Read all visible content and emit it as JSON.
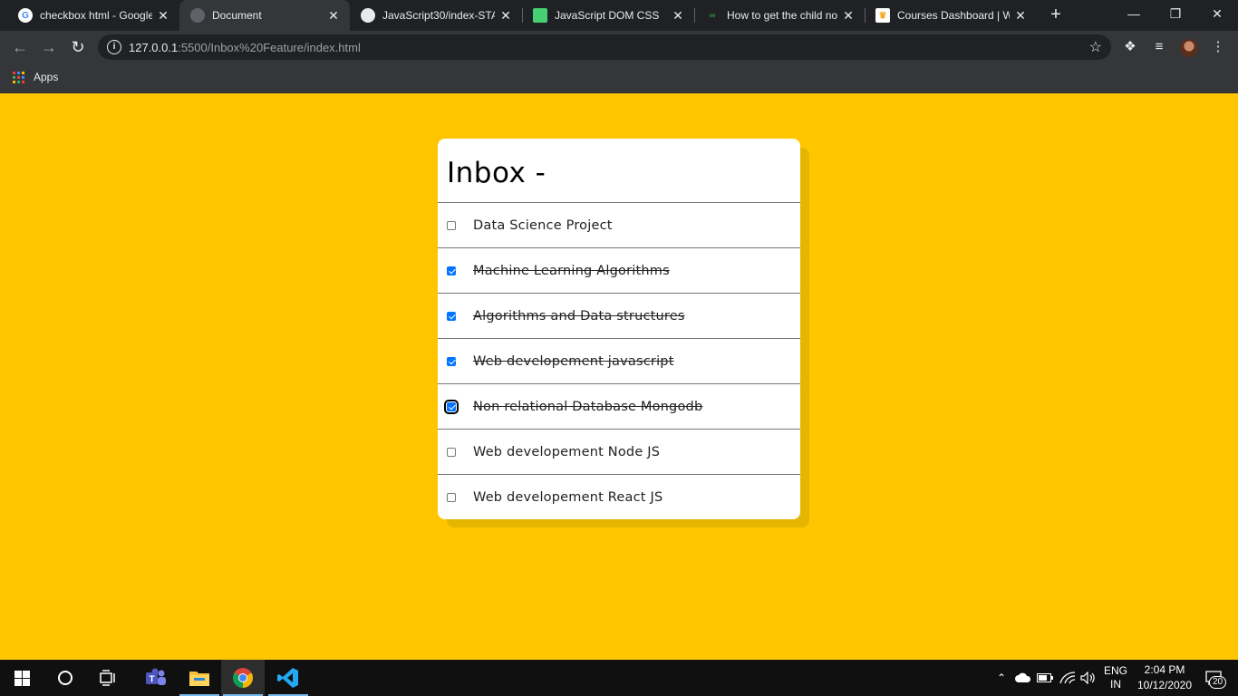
{
  "browser": {
    "tabs": [
      {
        "title": "checkbox html - Google",
        "favicon": "google-icon",
        "active": false
      },
      {
        "title": "Document",
        "favicon": "globe-icon",
        "active": true
      },
      {
        "title": "JavaScript30/index-STA",
        "favicon": "github-icon",
        "active": false
      },
      {
        "title": "JavaScript DOM CSS",
        "favicon": "codepen-icon",
        "active": false
      },
      {
        "title": "How to get the child no",
        "favicon": "geeksforgeeks-icon",
        "active": false
      },
      {
        "title": "Courses Dashboard | W",
        "favicon": "crown-icon",
        "active": false
      }
    ],
    "close_glyph": "✕",
    "new_tab_glyph": "+",
    "url_host": "127.0.0.1",
    "url_rest": ":5500/Inbox%20Feature/index.html",
    "bookmarks": {
      "apps_label": "Apps"
    }
  },
  "page": {
    "title": "Inbox -",
    "items": [
      {
        "label": "Data Science Project",
        "checked": false
      },
      {
        "label": "Machine Learning Algorithms",
        "checked": true
      },
      {
        "label": "Algorithms and Data structures",
        "checked": true
      },
      {
        "label": "Web developement  javascript",
        "checked": true
      },
      {
        "label": "Non relational Database Mongodb",
        "checked": true,
        "focused": true
      },
      {
        "label": "Web developement Node JS",
        "checked": false
      },
      {
        "label": "Web developement React JS",
        "checked": false
      }
    ]
  },
  "taskbar": {
    "language_top": "ENG",
    "language_bottom": "IN",
    "time": "2:04 PM",
    "date": "10/12/2020",
    "notification_count": "20"
  },
  "colors": {
    "page_background": "#ffc600",
    "checkbox_accent": "#0075ff"
  }
}
